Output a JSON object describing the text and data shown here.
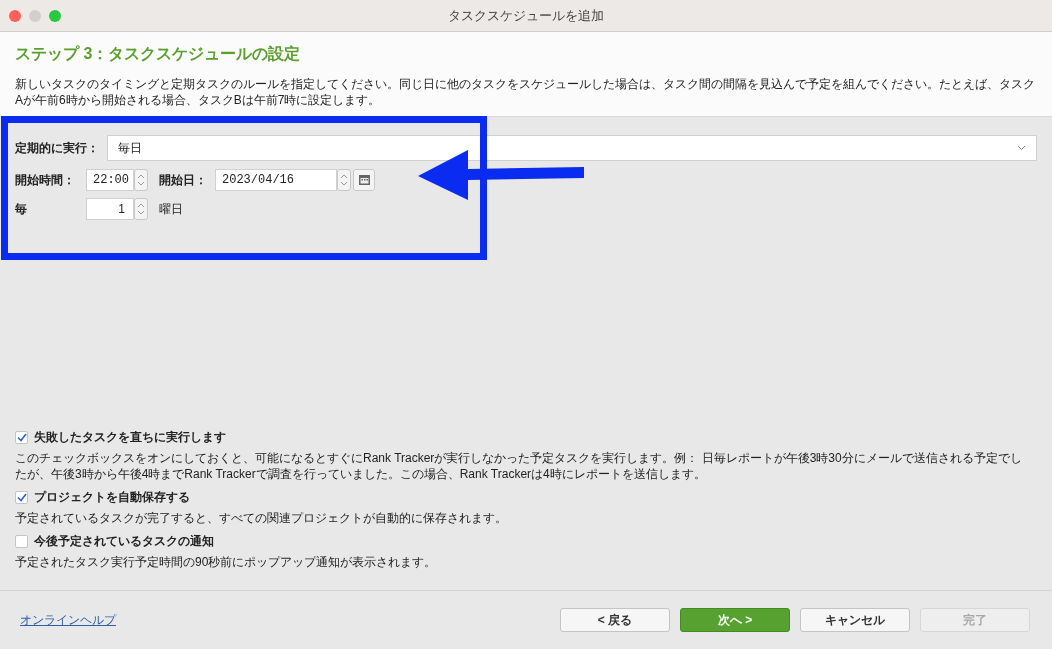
{
  "window": {
    "title": "タスクスケジュールを追加"
  },
  "header": {
    "title": "ステップ 3：タスクスケジュールの設定",
    "description": "新しいタスクのタイミングと定期タスクのルールを指定してください。同じ日に他のタスクをスケジュールした場合は、タスク間の間隔を見込んで予定を組んでください。たとえば、タスクAが午前6時から開始される場合、タスクBは午前7時に設定します。"
  },
  "schedule": {
    "repeat_label": "定期的に実行：",
    "repeat_value": "毎日",
    "start_time_label": "開始時間：",
    "start_time": "22:00",
    "start_date_label": "開始日：",
    "start_date": "2023/04/16",
    "every_label": "毎",
    "every_value": "1",
    "every_unit": "曜日"
  },
  "options": [
    {
      "label": "失敗したタスクを直ちに実行します",
      "checked": true,
      "description": "このチェックボックスをオンにしておくと、可能になるとすぐにRank Trackerが実行しなかった予定タスクを実行します。例： 日毎レポートが午後3時30分にメールで送信される予定でしたが、午後3時から午後4時までRank Trackerで調査を行っていました。この場合、Rank Trackerは4時にレポートを送信します。"
    },
    {
      "label": "プロジェクトを自動保存する",
      "checked": true,
      "description": "予定されているタスクが完了すると、すべての関連プロジェクトが自動的に保存されます。"
    },
    {
      "label": "今後予定されているタスクの通知",
      "checked": false,
      "description": "予定されたタスク実行予定時間の90秒前にポップアップ通知が表示されます。"
    }
  ],
  "footer": {
    "help_link": "オンラインヘルプ",
    "buttons": [
      {
        "label": "< 戻る",
        "kind": "normal"
      },
      {
        "label": "次へ >",
        "kind": "primary"
      },
      {
        "label": "キャンセル",
        "kind": "normal"
      },
      {
        "label": "完了",
        "kind": "disabled"
      }
    ]
  }
}
